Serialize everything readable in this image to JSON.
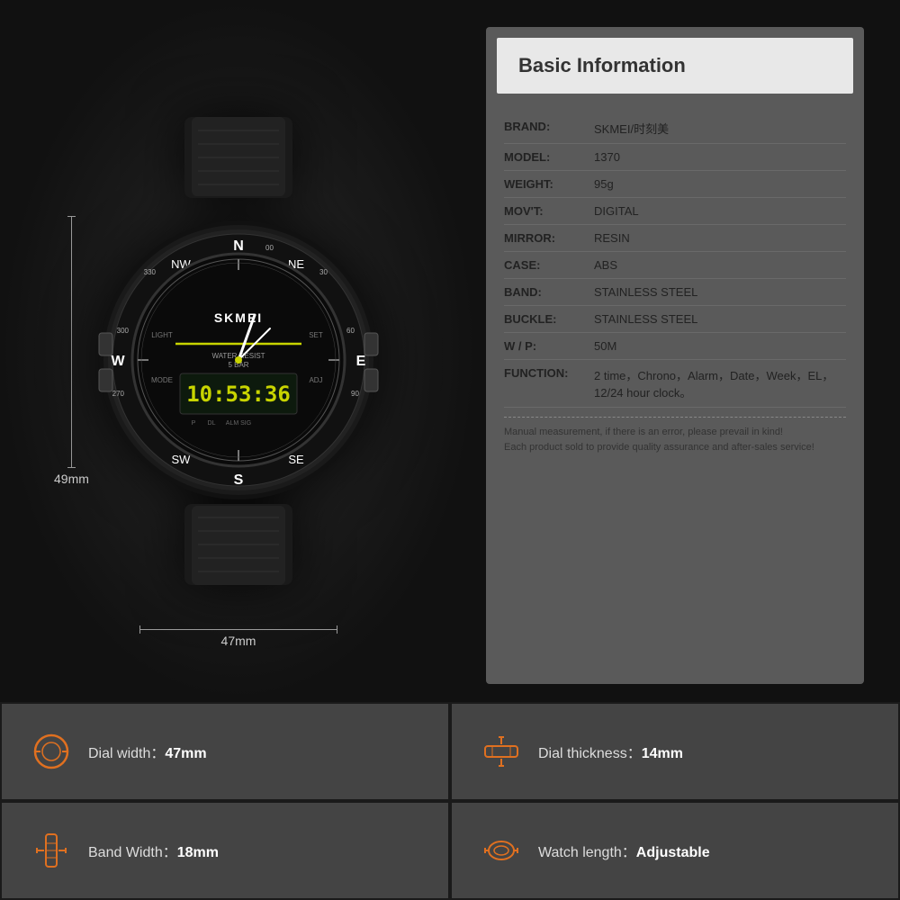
{
  "info": {
    "title": "Basic Information",
    "rows": [
      {
        "label": "BRAND:",
        "value": "SKMEI/时刻美"
      },
      {
        "label": "MODEL:",
        "value": "1370"
      },
      {
        "label": "WEIGHT:",
        "value": "95g"
      },
      {
        "label": "MOV'T:",
        "value": "DIGITAL"
      },
      {
        "label": "MIRROR:",
        "value": "RESIN"
      },
      {
        "label": "CASE:",
        "value": "ABS"
      },
      {
        "label": "BAND:",
        "value": "STAINLESS STEEL"
      },
      {
        "label": "BUCKLE:",
        "value": "STAINLESS STEEL"
      },
      {
        "label": "W / P:",
        "value": "50M"
      },
      {
        "label": "FUNCTION:",
        "value": "2 time，Chrono，Alarm，Date，Week，EL，12/24 hour clock。"
      }
    ],
    "note": "Manual measurement, if there is an error, please prevail in kind!\nEach product sold to provide quality assurance and after-sales service!"
  },
  "dimensions": {
    "height": "49mm",
    "width": "47mm"
  },
  "metrics": [
    {
      "icon": "⊙",
      "label": "Dial width：",
      "value": "47mm",
      "id": "dial-width"
    },
    {
      "icon": "⊟",
      "label": "Dial thickness：",
      "value": "14mm",
      "id": "dial-thickness"
    },
    {
      "icon": "▯",
      "label": "Band Width：",
      "value": "18mm",
      "id": "band-width"
    },
    {
      "icon": "◎",
      "label": "Watch length：",
      "value": "Adjustable",
      "id": "watch-length"
    }
  ]
}
